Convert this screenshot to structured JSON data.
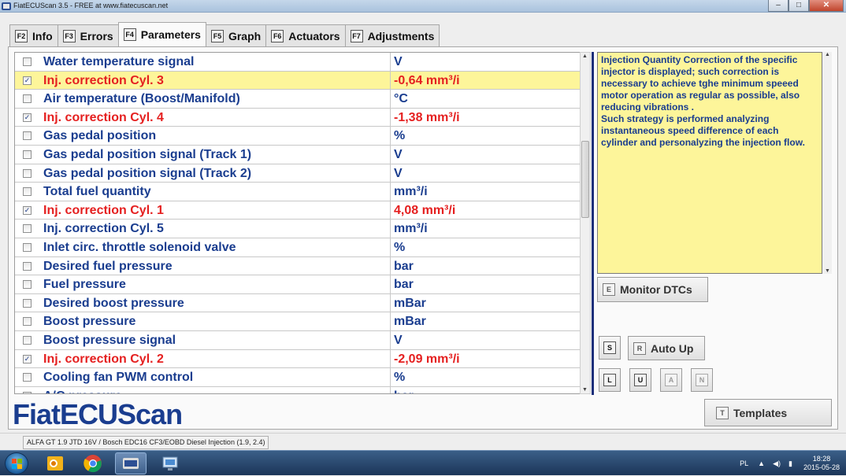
{
  "window": {
    "title": "FiatECUScan 3.5 - FREE at www.fiatecuscan.net"
  },
  "tabs": [
    {
      "key": "F2",
      "label": "Info"
    },
    {
      "key": "F3",
      "label": "Errors"
    },
    {
      "key": "F4",
      "label": "Parameters"
    },
    {
      "key": "F5",
      "label": "Graph"
    },
    {
      "key": "F6",
      "label": "Actuators"
    },
    {
      "key": "F7",
      "label": "Adjustments"
    }
  ],
  "parameters": [
    {
      "name": "Water temperature signal",
      "value": "V",
      "checked": false,
      "selected": false,
      "red": false
    },
    {
      "name": "Inj. correction Cyl. 3",
      "value": "-0,64 mm³/i",
      "checked": true,
      "selected": true,
      "red": true
    },
    {
      "name": "Air temperature (Boost/Manifold)",
      "value": "°C",
      "checked": false,
      "selected": false,
      "red": false
    },
    {
      "name": "Inj. correction Cyl. 4",
      "value": "-1,38 mm³/i",
      "checked": true,
      "selected": false,
      "red": true
    },
    {
      "name": "Gas pedal position",
      "value": "%",
      "checked": false,
      "selected": false,
      "red": false
    },
    {
      "name": "Gas pedal position signal (Track 1)",
      "value": "V",
      "checked": false,
      "selected": false,
      "red": false
    },
    {
      "name": "Gas pedal position signal (Track 2)",
      "value": "V",
      "checked": false,
      "selected": false,
      "red": false
    },
    {
      "name": "Total fuel quantity",
      "value": "mm³/i",
      "checked": false,
      "selected": false,
      "red": false
    },
    {
      "name": "Inj. correction Cyl. 1",
      "value": "4,08 mm³/i",
      "checked": true,
      "selected": false,
      "red": true
    },
    {
      "name": "Inj. correction Cyl. 5",
      "value": "mm³/i",
      "checked": false,
      "selected": false,
      "red": false
    },
    {
      "name": "Inlet circ. throttle solenoid valve",
      "value": "%",
      "checked": false,
      "selected": false,
      "red": false
    },
    {
      "name": "Desired fuel pressure",
      "value": "bar",
      "checked": false,
      "selected": false,
      "red": false
    },
    {
      "name": "Fuel pressure",
      "value": "bar",
      "checked": false,
      "selected": false,
      "red": false
    },
    {
      "name": "Desired boost pressure",
      "value": "mBar",
      "checked": false,
      "selected": false,
      "red": false
    },
    {
      "name": "Boost pressure",
      "value": "mBar",
      "checked": false,
      "selected": false,
      "red": false
    },
    {
      "name": "Boost pressure signal",
      "value": "V",
      "checked": false,
      "selected": false,
      "red": false
    },
    {
      "name": "Inj. correction Cyl. 2",
      "value": "-2,09 mm³/i",
      "checked": true,
      "selected": false,
      "red": true
    },
    {
      "name": "Cooling fan PWM control",
      "value": "%",
      "checked": false,
      "selected": false,
      "red": false
    },
    {
      "name": "A/C pressure",
      "value": "bar",
      "checked": false,
      "selected": false,
      "red": false
    }
  ],
  "info_text": "Injection Quantity Correction of the specific injector is displayed; such correction is necessary to achieve tghe minimum speeed motor operation as regular as possible, also reducing vibrations .\nSuch strategy is performed analyzing instantaneous speed difference of each cylinder and personalyzing the injection flow.",
  "buttons": {
    "monitor_dtcs": {
      "key": "E",
      "label": "Monitor DTCs"
    },
    "s": {
      "key": "S"
    },
    "auto_up": {
      "key": "R",
      "label": "Auto Up"
    },
    "l": {
      "key": "L"
    },
    "u": {
      "key": "U"
    },
    "a": {
      "key": "A"
    },
    "n": {
      "key": "N"
    },
    "templates": {
      "key": "T",
      "label": "Templates"
    }
  },
  "logo": "FiatECUScan",
  "status": "ALFA GT 1.9 JTD 16V / Bosch EDC16 CF3/EOBD Diesel Injection (1.9, 2.4)",
  "taskbar": {
    "lang": "PL",
    "time": "18:28",
    "date": "2015-05-28"
  },
  "colors": {
    "param_blue": "#1a3d8f",
    "param_red": "#e52020",
    "highlight_yellow": "#fdf59a",
    "divider_navy": "#1d2f7a"
  }
}
